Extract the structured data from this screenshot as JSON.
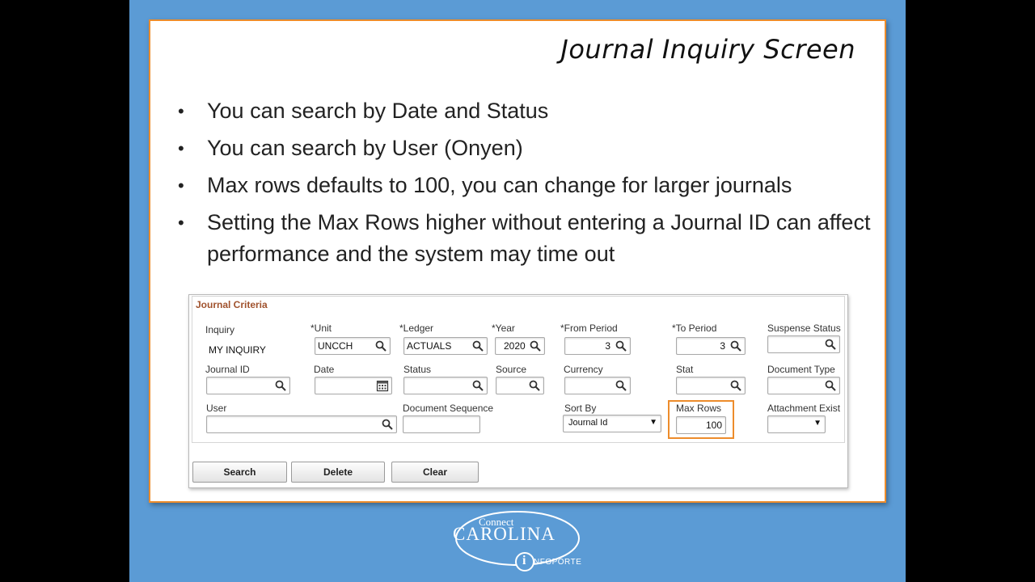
{
  "slide": {
    "title": "Journal Inquiry Screen",
    "bullets": [
      "You can search by Date and Status",
      "You can search by User (Onyen)",
      "Max rows defaults to 100, you can change for larger journals",
      "Setting the Max Rows higher without entering a Journal ID can affect performance and the system may time out"
    ],
    "bullet_symbol": "•"
  },
  "panel": {
    "group_title": "Journal Criteria",
    "inquiry_label": "Inquiry",
    "inquiry_value": "MY INQUIRY",
    "unit": {
      "label": "*Unit",
      "value": "UNCCH"
    },
    "ledger": {
      "label": "*Ledger",
      "value": "ACTUALS"
    },
    "year": {
      "label": "*Year",
      "value": "2020"
    },
    "from_period": {
      "label": "*From Period",
      "value": "3"
    },
    "to_period": {
      "label": "*To Period",
      "value": "3"
    },
    "suspense_status": {
      "label": "Suspense Status",
      "value": ""
    },
    "journal_id": {
      "label": "Journal ID",
      "value": ""
    },
    "date": {
      "label": "Date",
      "value": ""
    },
    "status": {
      "label": "Status",
      "value": ""
    },
    "source": {
      "label": "Source",
      "value": ""
    },
    "currency": {
      "label": "Currency",
      "value": ""
    },
    "stat": {
      "label": "Stat",
      "value": ""
    },
    "document_type": {
      "label": "Document Type",
      "value": ""
    },
    "user": {
      "label": "User",
      "value": ""
    },
    "document_sequence": {
      "label": "Document Sequence",
      "value": ""
    },
    "sort_by": {
      "label": "Sort By",
      "value": "Journal Id"
    },
    "max_rows": {
      "label": "Max Rows",
      "value": "100"
    },
    "attachment_exist": {
      "label": "Attachment Exist",
      "value": ""
    },
    "buttons": {
      "search": "Search",
      "delete": "Delete",
      "clear": "Clear"
    }
  },
  "logo": {
    "connect": "Connect",
    "carolina": "CAROLINA",
    "infoporte": "NFOPORTE",
    "info_letter": "i"
  },
  "colors": {
    "background": "#5b9bd5",
    "accent_border": "#ed8c2b",
    "group_title": "#a0522d"
  },
  "icons": {
    "lookup": "magnifier-icon",
    "calendar": "calendar-icon",
    "dropdown": "chevron-down-icon"
  }
}
